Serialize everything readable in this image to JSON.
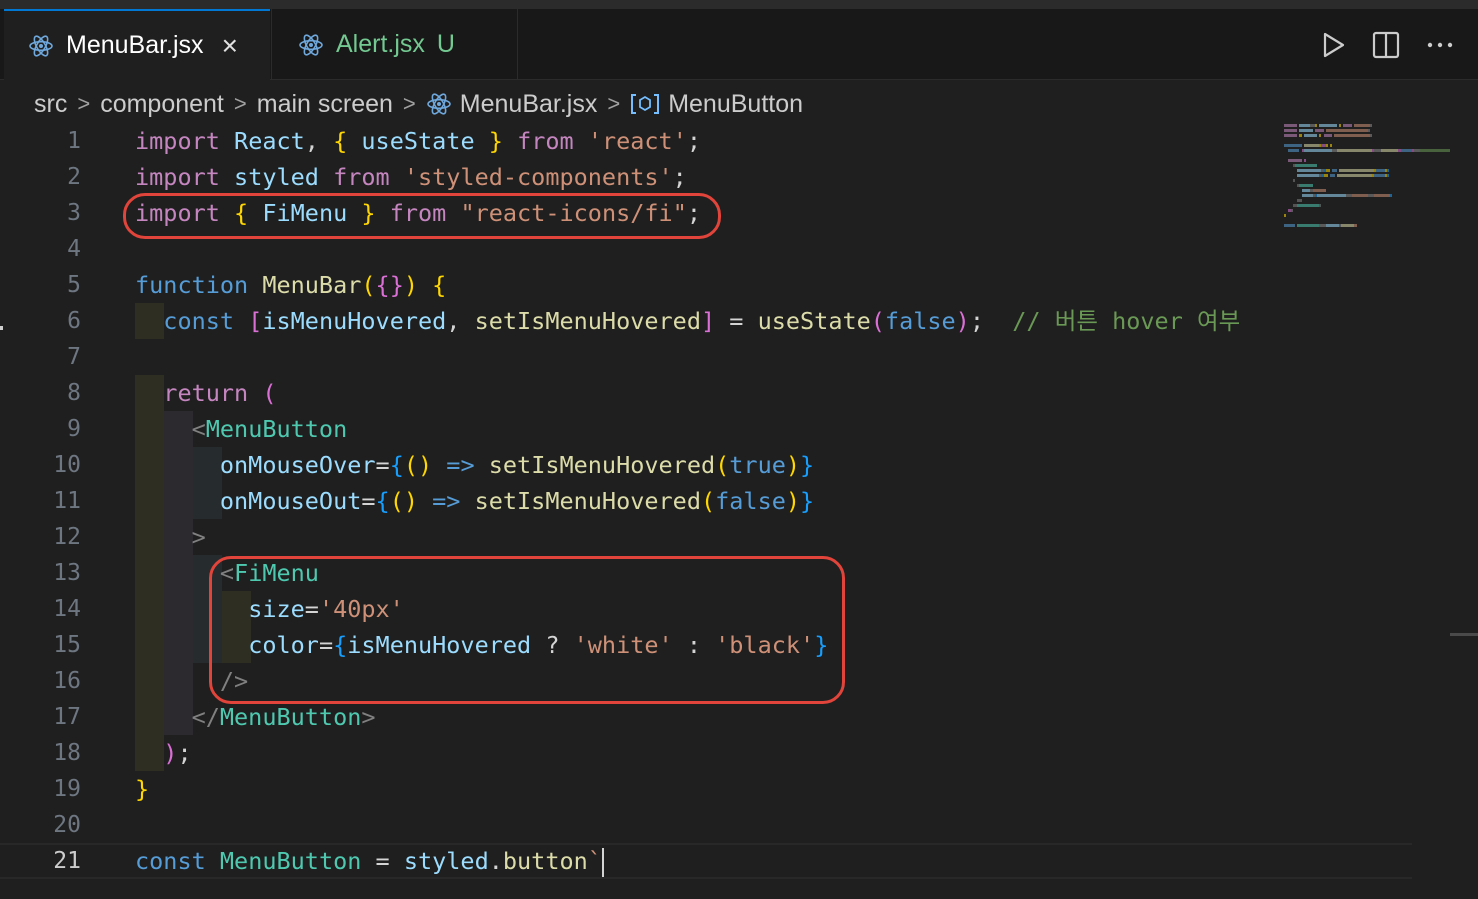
{
  "tabs": [
    {
      "label": "MenuBar.jsx",
      "active": true,
      "close": "×",
      "icon": "react-icon"
    },
    {
      "label": "Alert.jsx",
      "active": false,
      "badge": "U",
      "icon": "react-icon"
    }
  ],
  "editor_actions": [
    "run-icon",
    "split-editor-icon",
    "more-actions-icon"
  ],
  "breadcrumb": {
    "segments": [
      "src",
      "component",
      "main screen",
      "MenuBar.jsx",
      "MenuButton"
    ],
    "separator": ">"
  },
  "line_numbers": [
    "1",
    "2",
    "3",
    "4",
    "5",
    "6",
    "7",
    "8",
    "9",
    "10",
    "11",
    "12",
    "13",
    "14",
    "15",
    "16",
    "17",
    "18",
    "19",
    "20",
    "21"
  ],
  "current_line": "21",
  "code_lines": [
    [
      [
        "kw",
        "import"
      ],
      [
        "op",
        " "
      ],
      [
        "va",
        "React"
      ],
      [
        "op",
        ", "
      ],
      [
        "b1",
        "{"
      ],
      [
        "op",
        " "
      ],
      [
        "va",
        "useState"
      ],
      [
        "op",
        " "
      ],
      [
        "b1",
        "}"
      ],
      [
        "op",
        " "
      ],
      [
        "kw",
        "from"
      ],
      [
        "op",
        " "
      ],
      [
        "st",
        "'react'"
      ],
      [
        "op",
        ";"
      ]
    ],
    [
      [
        "kw",
        "import"
      ],
      [
        "op",
        " "
      ],
      [
        "va",
        "styled"
      ],
      [
        "op",
        " "
      ],
      [
        "kw",
        "from"
      ],
      [
        "op",
        " "
      ],
      [
        "st",
        "'styled-components'"
      ],
      [
        "op",
        ";"
      ]
    ],
    [
      [
        "kw",
        "import"
      ],
      [
        "op",
        " "
      ],
      [
        "b1",
        "{"
      ],
      [
        "op",
        " "
      ],
      [
        "va",
        "FiMenu"
      ],
      [
        "op",
        " "
      ],
      [
        "b1",
        "}"
      ],
      [
        "op",
        " "
      ],
      [
        "kw",
        "from"
      ],
      [
        "op",
        " "
      ],
      [
        "st",
        "\"react-icons/fi\""
      ],
      [
        "op",
        ";"
      ]
    ],
    [],
    [
      [
        "kb",
        "function"
      ],
      [
        "op",
        " "
      ],
      [
        "fn",
        "MenuBar"
      ],
      [
        "b1",
        "("
      ],
      [
        "b2",
        "{}"
      ],
      [
        "b1",
        ")"
      ],
      [
        "op",
        " "
      ],
      [
        "b1",
        "{"
      ]
    ],
    [
      [
        "op",
        "  "
      ],
      [
        "kb",
        "const"
      ],
      [
        "op",
        " "
      ],
      [
        "b2",
        "["
      ],
      [
        "va",
        "isMenuHovered"
      ],
      [
        "op",
        ", "
      ],
      [
        "fn",
        "setIsMenuHovered"
      ],
      [
        "b2",
        "]"
      ],
      [
        "op",
        " = "
      ],
      [
        "fn",
        "useState"
      ],
      [
        "b2",
        "("
      ],
      [
        "kb",
        "false"
      ],
      [
        "b2",
        ")"
      ],
      [
        "op",
        ";  "
      ],
      [
        "cm",
        "// 버튼 hover 여부"
      ]
    ],
    [],
    [
      [
        "op",
        "  "
      ],
      [
        "kw",
        "return"
      ],
      [
        "op",
        " "
      ],
      [
        "b2",
        "("
      ]
    ],
    [
      [
        "op",
        "    "
      ],
      [
        "pu",
        "<"
      ],
      [
        "tg",
        "MenuButton"
      ]
    ],
    [
      [
        "op",
        "      "
      ],
      [
        "va",
        "onMouseOver"
      ],
      [
        "op",
        "="
      ],
      [
        "b3",
        "{"
      ],
      [
        "b1",
        "()"
      ],
      [
        "op",
        " "
      ],
      [
        "kb",
        "=>"
      ],
      [
        "op",
        " "
      ],
      [
        "fn",
        "setIsMenuHovered"
      ],
      [
        "b1",
        "("
      ],
      [
        "kb",
        "true"
      ],
      [
        "b1",
        ")"
      ],
      [
        "b3",
        "}"
      ]
    ],
    [
      [
        "op",
        "      "
      ],
      [
        "va",
        "onMouseOut"
      ],
      [
        "op",
        "="
      ],
      [
        "b3",
        "{"
      ],
      [
        "b1",
        "()"
      ],
      [
        "op",
        " "
      ],
      [
        "kb",
        "=>"
      ],
      [
        "op",
        " "
      ],
      [
        "fn",
        "setIsMenuHovered"
      ],
      [
        "b1",
        "("
      ],
      [
        "kb",
        "false"
      ],
      [
        "b1",
        ")"
      ],
      [
        "b3",
        "}"
      ]
    ],
    [
      [
        "op",
        "    "
      ],
      [
        "pu",
        ">"
      ]
    ],
    [
      [
        "op",
        "      "
      ],
      [
        "pu",
        "<"
      ],
      [
        "tg",
        "FiMenu"
      ]
    ],
    [
      [
        "op",
        "        "
      ],
      [
        "va",
        "size"
      ],
      [
        "op",
        "="
      ],
      [
        "st",
        "'40px'"
      ]
    ],
    [
      [
        "op",
        "        "
      ],
      [
        "va",
        "color"
      ],
      [
        "op",
        "="
      ],
      [
        "b3",
        "{"
      ],
      [
        "va",
        "isMenuHovered"
      ],
      [
        "op",
        " ? "
      ],
      [
        "st",
        "'white'"
      ],
      [
        "op",
        " : "
      ],
      [
        "st",
        "'black'"
      ],
      [
        "b3",
        "}"
      ]
    ],
    [
      [
        "op",
        "      "
      ],
      [
        "pu",
        "/>"
      ]
    ],
    [
      [
        "op",
        "    "
      ],
      [
        "pu",
        "</"
      ],
      [
        "tg",
        "MenuButton"
      ],
      [
        "pu",
        ">"
      ]
    ],
    [
      [
        "op",
        "  "
      ],
      [
        "b2",
        ")"
      ],
      [
        "op",
        ";"
      ]
    ],
    [
      [
        "b1",
        "}"
      ]
    ],
    [],
    [
      [
        "kb",
        "const"
      ],
      [
        "op",
        " "
      ],
      [
        "tg",
        "MenuButton"
      ],
      [
        "op",
        " = "
      ],
      [
        "va",
        "styled"
      ],
      [
        "op",
        "."
      ],
      [
        "fn",
        "button"
      ],
      [
        "st",
        "`"
      ]
    ]
  ],
  "colors": {
    "background": "#1f1f1f",
    "tab_active_border": "#0078d4",
    "annotation_red": "#e0443a",
    "untracked_green": "#73c991"
  }
}
